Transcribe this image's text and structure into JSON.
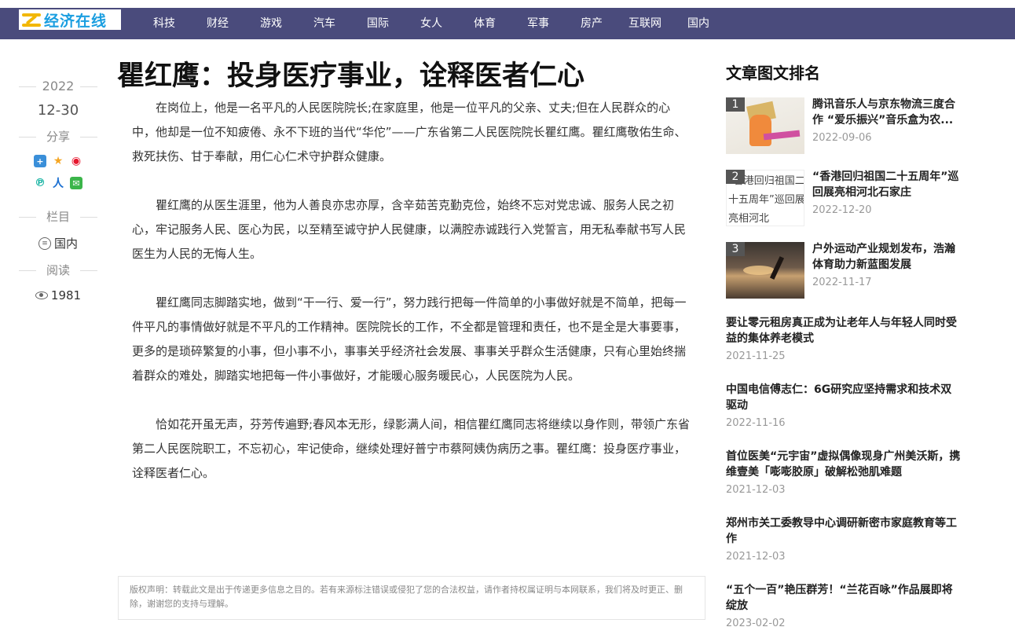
{
  "header": {
    "logo_text": "经济在线",
    "nav": [
      "科技",
      "财经",
      "游戏",
      "汽车",
      "国际",
      "女人",
      "体育",
      "军事",
      "房产",
      "互联网",
      "国内"
    ]
  },
  "meta": {
    "year": "2022",
    "date": "12-30",
    "share_label": "分享",
    "share_icons": [
      "plus-icon",
      "qzone-icon",
      "weibo-icon",
      "pinterest-icon",
      "renren-icon",
      "wechat-icon"
    ],
    "category_label": "栏目",
    "category": "国内",
    "read_label": "阅读",
    "read_count": "1981"
  },
  "article": {
    "title": "瞿红鹰：投身医疗事业，诠释医者仁心",
    "paragraphs": [
      "在岗位上，他是一名平凡的人民医院院长;在家庭里，他是一位平凡的父亲、丈夫;但在人民群众的心中，他却是一位不知疲倦、永不下班的当代“华佗”——广东省第二人民医院院长瞿红鹰。瞿红鹰敬佑生命、救死扶伤、甘于奉献，用仁心仁术守护群众健康。",
      "瞿红鹰的从医生涯里，他为人善良亦忠亦厚，含辛茹苦克勤克俭，始终不忘对党忠诚、服务人民之初心，牢记服务人民、医心为民，以至精至诚守护人民健康，以满腔赤诚践行入党誓言，用无私奉献书写人民医生为人民的无悔人生。",
      "瞿红鹰同志脚踏实地，做到“干一行、爱一行”，努力践行把每一件简单的小事做好就是不简单，把每一件平凡的事情做好就是不平凡的工作精神。医院院长的工作，不全都是管理和责任，也不是全是大事要事，更多的是琐碎繁复的小事，但小事不小，事事关乎经济社会发展、事事关乎群众生活健康，只有心里始终揣着群众的难处，脚踏实地把每一件小事做好，才能暖心服务暖民心，人民医院为人民。",
      "恰如花开虽无声，芬芳传遍野;春风本无形，绿影满人间，相信瞿红鹰同志将继续以身作则，带领广东省第二人民医院职工，不忘初心，牢记使命，继续处理好普宁市蔡阿姨伪病历之事。瞿红鹰：投身医疗事业，诠释医者仁心。"
    ],
    "copyright": "版权声明：转载此文是出于传递更多信息之目的。若有来源标注错误或侵犯了您的合法权益，请作者持权属证明与本网联系，我们将及时更正、删除，谢谢您的支持与理解。"
  },
  "sidebar": {
    "title": "文章图文排名",
    "ranked": [
      {
        "num": "1",
        "title": "腾讯音乐人与京东物流三度合作 “爱乐振兴”音乐盒为农...",
        "date": "2022-09-06"
      },
      {
        "num": "2",
        "thumb_caption": "“香港回归祖国二十五周年”巡回展亮相河北",
        "title": "“香港回归祖国二十五周年”巡回展亮相河北石家庄",
        "date": "2022-12-20"
      },
      {
        "num": "3",
        "title": "户外运动产业规划发布，浩瀚体育助力新蓝图发展",
        "date": "2022-11-17"
      }
    ],
    "news": [
      {
        "title": "要让零元租房真正成为让老年人与年轻人同时受益的集体养老模式",
        "date": "2021-11-25"
      },
      {
        "title": "中国电信傅志仁：6G研究应坚持需求和技术双驱动",
        "date": "2022-11-16"
      },
      {
        "title": "首位医美“元宇宙”虚拟偶像现身广州美沃斯，携维壹美「嘭嘭胶原」破解松弛肌难题",
        "date": "2021-12-03"
      },
      {
        "title": "郑州市关工委教导中心调研新密市家庭教育等工作",
        "date": "2021-12-03"
      },
      {
        "title": "“五个一百”艳压群芳！“兰花百咏”作品展即将绽放",
        "date": "2023-02-02"
      }
    ]
  }
}
